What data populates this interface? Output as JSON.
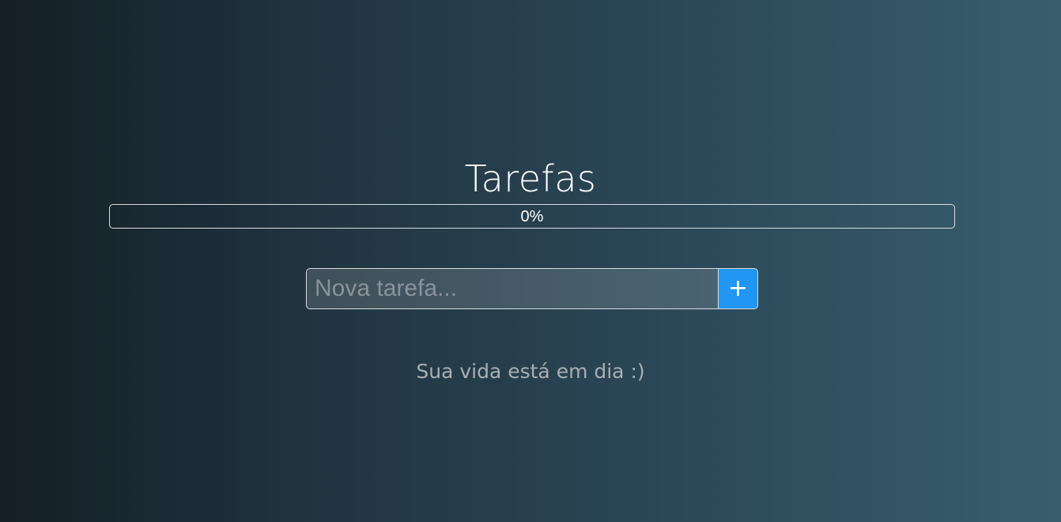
{
  "app": {
    "title": "Tarefas"
  },
  "progress": {
    "label": "0%",
    "percent": 0
  },
  "form": {
    "input_placeholder": "Nova tarefa...",
    "input_value": "",
    "add_label": "+"
  },
  "tasks": [],
  "empty_message": "Sua vida está em dia :)",
  "colors": {
    "accent": "#2196f3",
    "border": "#d8dde0",
    "muted_text": "#a8afb3"
  }
}
